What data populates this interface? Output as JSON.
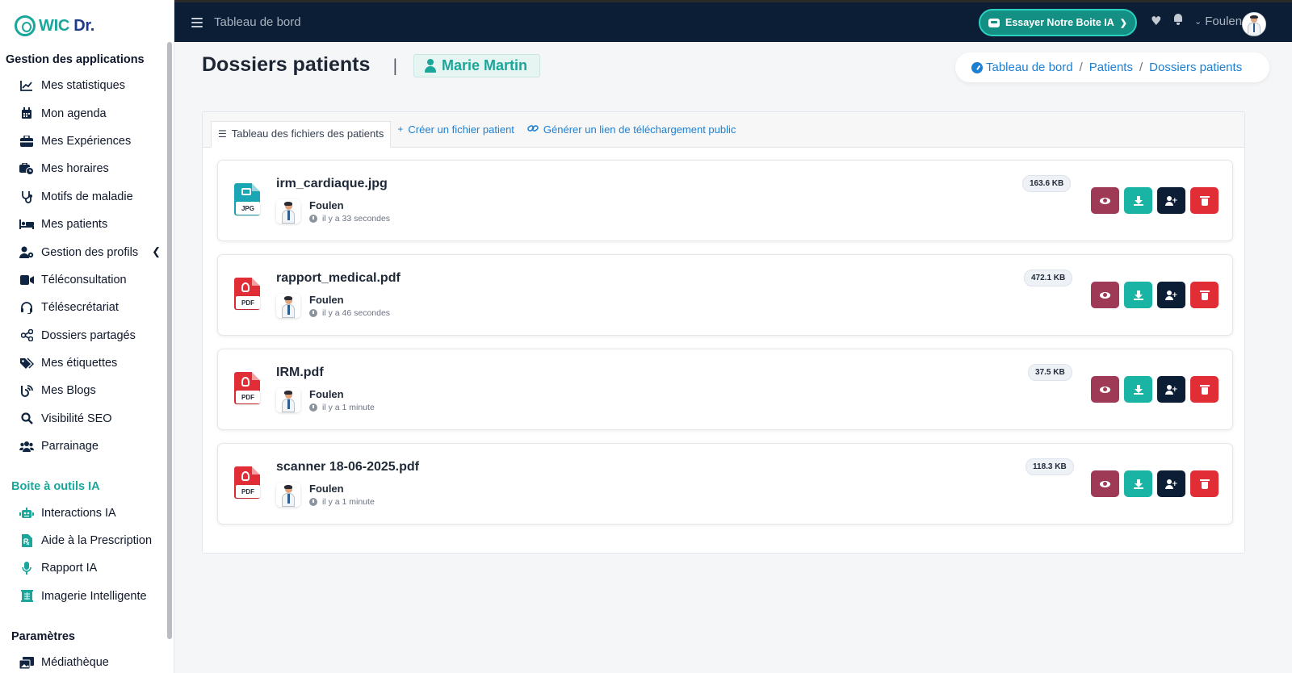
{
  "brand": {
    "wic": "WIC",
    "dr": "Dr.",
    "colors": {
      "teal": "#1aa69a",
      "navy": "#0c1e36",
      "link": "#1d7fd1"
    }
  },
  "sidebar": {
    "section_apps": "Gestion des applications",
    "items": [
      {
        "label": "Mes statistiques",
        "icon": "chart-line-icon"
      },
      {
        "label": "Mon agenda",
        "icon": "calendar-icon"
      },
      {
        "label": "Mes Expériences",
        "icon": "briefcase-icon"
      },
      {
        "label": "Mes horaires",
        "icon": "business-time-icon"
      },
      {
        "label": "Motifs de maladie",
        "icon": "stethoscope-icon"
      },
      {
        "label": "Mes patients",
        "icon": "hospital-bed-icon"
      },
      {
        "label": "Gestion des profils",
        "icon": "user-gear-icon"
      },
      {
        "label": "Téléconsultation",
        "icon": "video-icon"
      },
      {
        "label": "Télésecrétariat",
        "icon": "headset-icon"
      },
      {
        "label": "Dossiers partagés",
        "icon": "share-nodes-icon"
      },
      {
        "label": "Mes étiquettes",
        "icon": "tags-icon"
      },
      {
        "label": "Mes Blogs",
        "icon": "blog-icon"
      },
      {
        "label": "Visibilité SEO",
        "icon": "search-icon"
      },
      {
        "label": "Parrainage",
        "icon": "users-icon"
      }
    ],
    "section_ai": "Boite à outils IA",
    "ai_items": [
      {
        "label": "Interactions IA",
        "icon": "robot-icon"
      },
      {
        "label": "Aide à la Prescription",
        "icon": "prescription-icon"
      },
      {
        "label": "Rapport IA",
        "icon": "microphone-icon"
      },
      {
        "label": "Imagerie Intelligente",
        "icon": "x-ray-icon"
      }
    ],
    "section_params": "Paramètres",
    "param_items": [
      {
        "label": "Médiathèque",
        "icon": "photo-film-icon"
      }
    ]
  },
  "topbar": {
    "title": "Tableau de bord",
    "ia_button": "Essayer Notre Boite IA",
    "user_name": "Foulen"
  },
  "page": {
    "title": "Dossiers patients",
    "separator": "|",
    "patient_name": "Marie Martin"
  },
  "breadcrumb": {
    "items": [
      "Tableau de bord",
      "Patients",
      "Dossiers patients"
    ]
  },
  "tabs": [
    {
      "label": "Tableau des fichiers des patients",
      "icon": "list-icon"
    },
    {
      "label": "Créer un fichier patient",
      "icon": "plus-icon"
    },
    {
      "label": "Générer un lien de téléchargement public",
      "icon": "link-icon"
    }
  ],
  "files": [
    {
      "name": "irm_cardiaque.jpg",
      "ext": "JPG",
      "owner": "Foulen",
      "time": "il y a 33 secondes",
      "size": "163.6 KB",
      "icon_color": "#1aa6b4"
    },
    {
      "name": "rapport_medical.pdf",
      "ext": "PDF",
      "owner": "Foulen",
      "time": "il y a 46 secondes",
      "size": "472.1 KB",
      "icon_color": "#e02d36"
    },
    {
      "name": "IRM.pdf",
      "ext": "PDF",
      "owner": "Foulen",
      "time": "il y a 1 minute",
      "size": "37.5 KB",
      "icon_color": "#e02d36"
    },
    {
      "name": "scanner 18-06-2025.pdf",
      "ext": "PDF",
      "owner": "Foulen",
      "time": "il y a 1 minute",
      "size": "118.3 KB",
      "icon_color": "#e02d36"
    }
  ]
}
